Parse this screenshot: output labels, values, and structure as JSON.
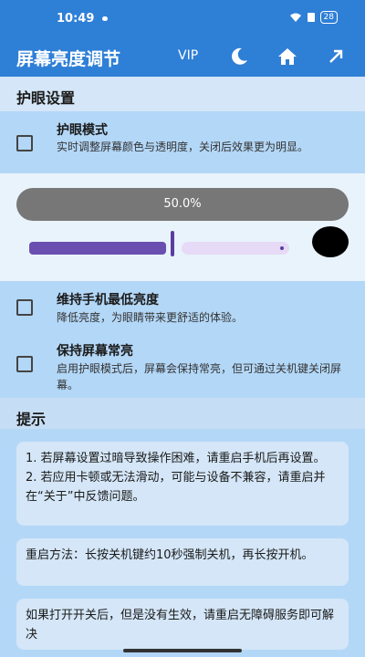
{
  "status_bar": {
    "time": "10:49",
    "battery": "28"
  },
  "app_bar": {
    "title": "屏幕亮度调节",
    "vip_label": "VIP",
    "icons": [
      "moon-icon",
      "home-icon",
      "arrow-up-right-icon"
    ]
  },
  "eye_section": {
    "header": "护眼设置",
    "eye_mode": {
      "title": "护眼模式",
      "desc": "实时调整屏幕颜色与透明度，关闭后效果更为明显。",
      "checked": false
    },
    "slider": {
      "percent_label": "50.0%",
      "value": 0.5
    },
    "min_brightness": {
      "title": "维持手机最低亮度",
      "desc": "降低亮度，为眼睛带来更舒适的体验。",
      "checked": false
    },
    "keep_on": {
      "title": "保持屏幕常亮",
      "desc": "启用护眼模式后，屏幕会保持常亮，但可通过关机键关闭屏幕。",
      "checked": false
    }
  },
  "tips_section": {
    "header": "提示",
    "card1_line1": "1. 若屏幕设置过暗导致操作困难，请重启手机后再设置。",
    "card1_line2": "2. 若应用卡顿或无法滑动，可能与设备不兼容，请重启并在“关于”中反馈问题。",
    "card2": "重启方法：长按关机键约10秒强制关机，再长按开机。",
    "card3": "如果打开开关后，但是没有生效，请重启无障碍服务即可解决"
  },
  "colors": {
    "primary": "#2e7fd6",
    "background": "#b3d7f7",
    "slider_fill": "#6a4fb0"
  }
}
